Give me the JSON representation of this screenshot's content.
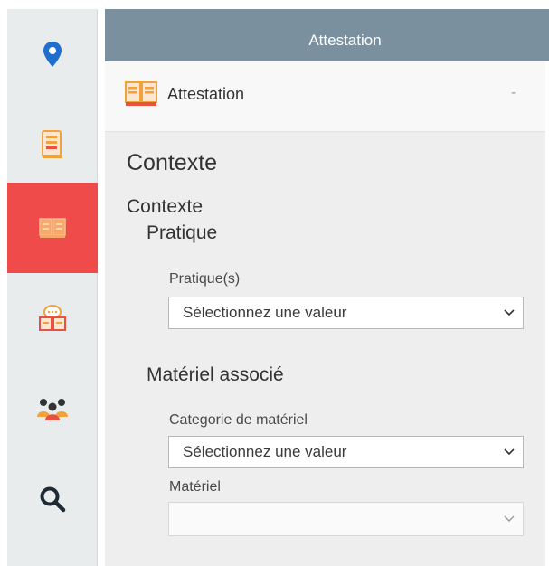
{
  "sidebar": {
    "items": [
      {
        "icon": "map-pin-icon"
      },
      {
        "icon": "book-document-icon"
      },
      {
        "icon": "open-book-icon",
        "active": true
      },
      {
        "icon": "book-chat-icon"
      },
      {
        "icon": "users-group-icon"
      },
      {
        "icon": "search-icon"
      }
    ]
  },
  "header": {
    "title": "Attestation"
  },
  "accordion": {
    "title": "Attestation",
    "toggle": "-"
  },
  "form": {
    "section_title": "Contexte",
    "group_title": "Contexte",
    "pratique": {
      "heading": "Pratique",
      "label": "Pratique(s)",
      "value": "Sélectionnez une valeur"
    },
    "materiel": {
      "heading": "Matériel associé",
      "categorie_label": "Categorie de matériel",
      "categorie_value": "Sélectionnez une valeur",
      "materiel_label": "Matériel",
      "materiel_value": ""
    }
  },
  "colors": {
    "topbar": "#7b909e",
    "active_item": "#f04b4b",
    "pin_blue": "#1f6fd1",
    "icon_orange": "#f2a23b",
    "icon_red": "#e8503f"
  }
}
